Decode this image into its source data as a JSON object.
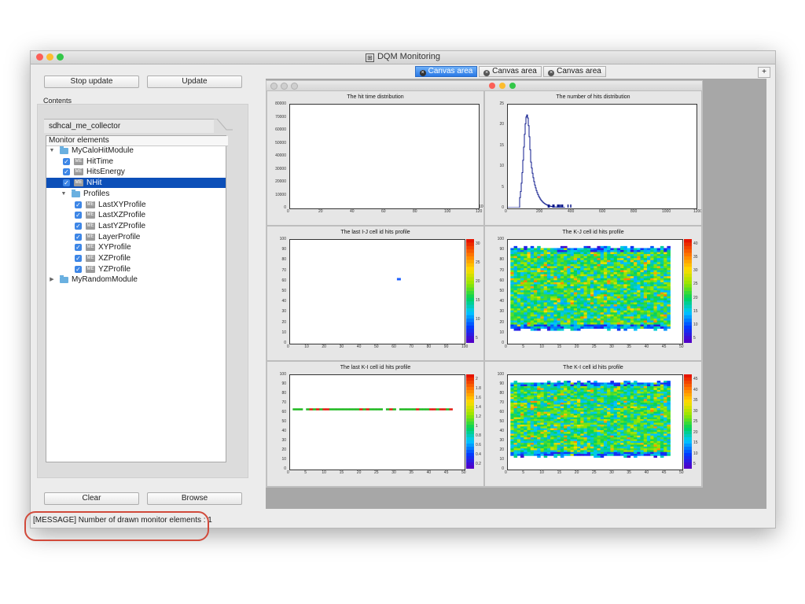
{
  "window": {
    "title": "DQM Monitoring"
  },
  "left": {
    "stop_update": "Stop update",
    "update": "Update",
    "contents_label": "Contents",
    "collector_tab": "sdhcal_me_collector",
    "tree_header": "Monitor elements",
    "me_badge": "ME",
    "tree": [
      {
        "label": "MyCaloHitModule",
        "type": "folder",
        "level": 0,
        "expanded": true
      },
      {
        "label": "HitTime",
        "type": "me",
        "level": 1,
        "checked": true
      },
      {
        "label": "HitsEnergy",
        "type": "me",
        "level": 1,
        "checked": true
      },
      {
        "label": "NHit",
        "type": "me",
        "level": 1,
        "checked": true,
        "selected": true
      },
      {
        "label": "Profiles",
        "type": "folder",
        "level": 1,
        "expanded": true
      },
      {
        "label": "LastXYProfile",
        "type": "me",
        "level": 2,
        "checked": true
      },
      {
        "label": "LastXZProfile",
        "type": "me",
        "level": 2,
        "checked": true
      },
      {
        "label": "LastYZProfile",
        "type": "me",
        "level": 2,
        "checked": true
      },
      {
        "label": "LayerProfile",
        "type": "me",
        "level": 2,
        "checked": true
      },
      {
        "label": "XYProfile",
        "type": "me",
        "level": 2,
        "checked": true
      },
      {
        "label": "XZProfile",
        "type": "me",
        "level": 2,
        "checked": true
      },
      {
        "label": "YZProfile",
        "type": "me",
        "level": 2,
        "checked": true
      },
      {
        "label": "MyRandomModule",
        "type": "folder",
        "level": 0,
        "expanded": false
      }
    ],
    "clear": "Clear",
    "browse": "Browse"
  },
  "status": {
    "message": "[MESSAGE] Number of drawn monitor elements : 1"
  },
  "canvas_tabs": [
    {
      "label": "Canvas area",
      "active": true
    },
    {
      "label": "Canvas area",
      "active": false
    },
    {
      "label": "Canvas area",
      "active": false
    }
  ],
  "add_tab": "+",
  "pads": [
    {
      "title": "The hit time distribution",
      "y_ticks": [
        "80000",
        "70000",
        "60000",
        "50000",
        "40000",
        "30000",
        "20000",
        "10000",
        "0"
      ],
      "x_ticks": [
        "0",
        "20",
        "40",
        "60",
        "80",
        "100",
        "120"
      ],
      "x_exp": "10³"
    },
    {
      "title": "The number of hits distribution",
      "y_ticks": [
        "25",
        "20",
        "15",
        "10",
        "5",
        "0"
      ],
      "x_ticks": [
        "0",
        "200",
        "400",
        "600",
        "800",
        "1000",
        "1200"
      ]
    },
    {
      "title": "The last I-J cell id hits profile",
      "y_ticks": [
        "100",
        "90",
        "80",
        "70",
        "60",
        "50",
        "40",
        "30",
        "20",
        "10",
        "0"
      ],
      "x_ticks": [
        "0",
        "10",
        "20",
        "30",
        "40",
        "50",
        "60",
        "70",
        "80",
        "90",
        "100"
      ],
      "z_ticks": [
        "30",
        "25",
        "20",
        "15",
        "10",
        "5"
      ]
    },
    {
      "title": "The K-J cell id hits profile",
      "y_ticks": [
        "100",
        "90",
        "80",
        "70",
        "60",
        "50",
        "40",
        "30",
        "20",
        "10",
        "0"
      ],
      "x_ticks": [
        "0",
        "5",
        "10",
        "15",
        "20",
        "25",
        "30",
        "35",
        "40",
        "45",
        "50"
      ],
      "z_ticks": [
        "40",
        "35",
        "30",
        "25",
        "20",
        "15",
        "10",
        "5"
      ]
    },
    {
      "title": "The last K-I cell id hits profile",
      "y_ticks": [
        "100",
        "90",
        "80",
        "70",
        "60",
        "50",
        "40",
        "30",
        "20",
        "10",
        "0"
      ],
      "x_ticks": [
        "0",
        "5",
        "10",
        "15",
        "20",
        "25",
        "30",
        "35",
        "40",
        "45",
        "50"
      ],
      "z_ticks": [
        "2",
        "1.8",
        "1.6",
        "1.4",
        "1.2",
        "1",
        "0.8",
        "0.6",
        "0.4",
        "0.2"
      ]
    },
    {
      "title": "The K-I cell id hits profile",
      "y_ticks": [
        "100",
        "90",
        "80",
        "70",
        "60",
        "50",
        "40",
        "30",
        "20",
        "10",
        "0"
      ],
      "x_ticks": [
        "0",
        "5",
        "10",
        "15",
        "20",
        "25",
        "30",
        "35",
        "40",
        "45",
        "50"
      ],
      "z_ticks": [
        "45",
        "40",
        "35",
        "30",
        "25",
        "20",
        "15",
        "10",
        "5"
      ]
    }
  ],
  "colors": {
    "selection": "#0c4fb8",
    "active_tab": "#2a79e6",
    "histogram_line": "#0d1a8c",
    "highlight_ring": "#d14a3b"
  }
}
